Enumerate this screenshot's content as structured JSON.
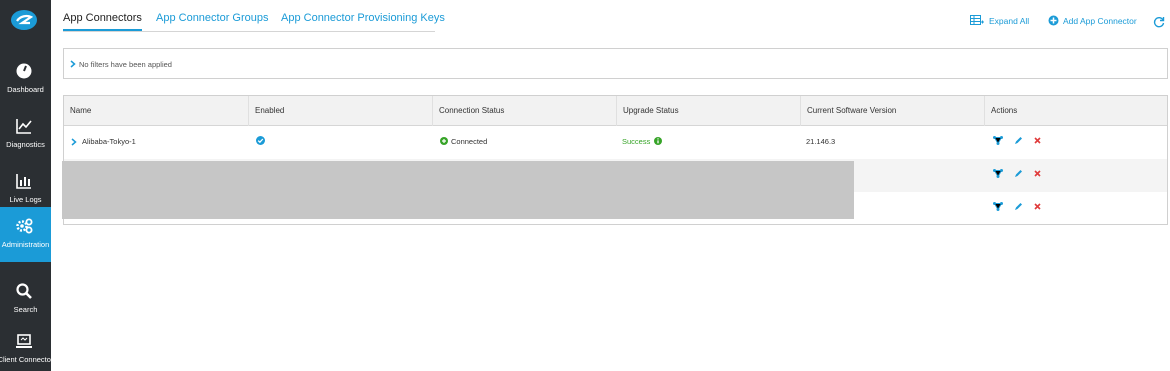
{
  "sidebar": {
    "items": [
      {
        "label": "Dashboard",
        "icon": "speedometer-icon"
      },
      {
        "label": "Diagnostics",
        "icon": "line-chart-icon"
      },
      {
        "label": "Live Logs",
        "icon": "bar-chart-icon"
      },
      {
        "label": "Administration",
        "icon": "gears-icon"
      },
      {
        "label": "Search",
        "icon": "search-icon"
      },
      {
        "label": "Client Connector",
        "icon": "laptop-icon"
      }
    ],
    "active": "Administration"
  },
  "tabs": [
    "App Connectors",
    "App Connector Groups",
    "App Connector Provisioning Keys"
  ],
  "toolbar": {
    "expand_all": "Expand All",
    "add_app_connector": "Add App Connector"
  },
  "filter": {
    "text": "No filters have been applied"
  },
  "table": {
    "columns": [
      "Name",
      "Enabled",
      "Connection Status",
      "Upgrade Status",
      "Current Software Version",
      "Actions"
    ],
    "rows": [
      {
        "name": "Alibaba-Tokyo-1",
        "enabled": true,
        "connection_status": "Connected",
        "upgrade_status": "Success",
        "software_version": "21.146.3"
      },
      {
        "name": "",
        "enabled": null,
        "connection_status": "",
        "upgrade_status": "",
        "software_version": ""
      },
      {
        "name": "",
        "enabled": null,
        "connection_status": "",
        "upgrade_status": "",
        "software_version": ""
      }
    ]
  },
  "colors": {
    "accent": "#1b9bd7",
    "sidebar": "#2b2f33",
    "success": "#37a428",
    "delete": "#e03b3b"
  }
}
